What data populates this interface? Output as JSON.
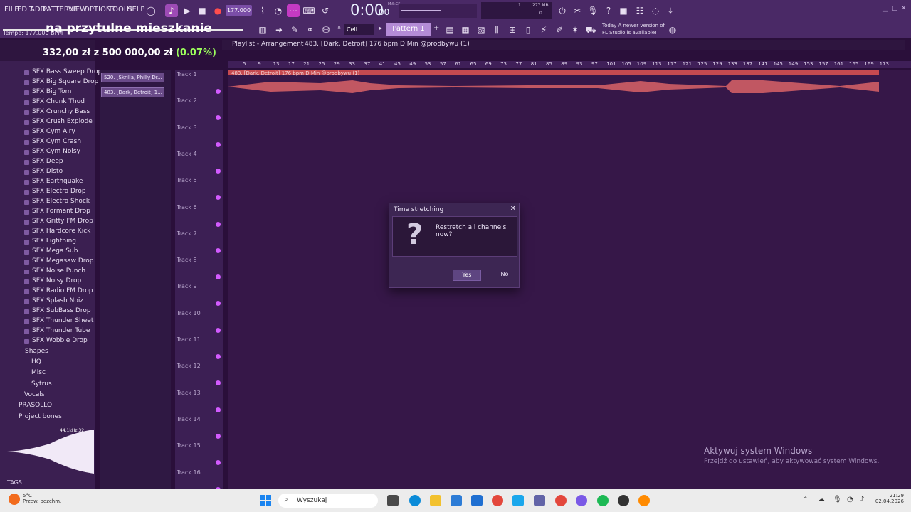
{
  "menu": [
    "FILE",
    "EDIT",
    "ADD",
    "PATTERNS",
    "VIEW",
    "OPTIONS",
    "TOOLS",
    "HELP"
  ],
  "transport": {
    "bpm": "177.000",
    "time": "0:00",
    "time_small": "00",
    "time_caption": "M:S:CS"
  },
  "pattern": "Pattern 1",
  "cell": "Cell",
  "cpu": {
    "mem": "277 MB",
    "line1": "1",
    "line2": "0"
  },
  "news": {
    "line1": "Today  A newer version of",
    "line2": "FL Studio is available!"
  },
  "overlay": {
    "title": "na przytulne mieszkanie",
    "tempo": "Tempo: 177.000 BPM"
  },
  "progress": {
    "current": "332,00 zł",
    "sep": " z ",
    "goal": "500 000,00 zł",
    "pct": "(0.07%)"
  },
  "browser": {
    "items": [
      "SFX Bass Sweep Drop",
      "SFX Big Square Drop",
      "SFX Big Tom",
      "SFX Chunk Thud",
      "SFX Crunchy Bass",
      "SFX Crush Explode",
      "SFX Cym Airy",
      "SFX Cym Crash",
      "SFX Cym Noisy",
      "SFX Deep",
      "SFX Disto",
      "SFX Earthquake",
      "SFX Electro Drop",
      "SFX Electro Shock",
      "SFX Formant Drop",
      "SFX Gritty FM Drop",
      "SFX Hardcore Kick",
      "SFX Lightning",
      "SFX Mega Sub",
      "SFX Megasaw Drop",
      "SFX Noise Punch",
      "SFX Noisy Drop",
      "SFX Radio FM Drop",
      "SFX Splash Noiz",
      "SFX SubBass Drop",
      "SFX Thunder Sheet",
      "SFX Thunder Tube",
      "SFX Wobble Drop"
    ],
    "groups": {
      "shapes": "Shapes",
      "hq": "HQ",
      "misc": "Misc",
      "sytrus": "Sytrus",
      "vocals": "Vocals",
      "prasollo": "PRASOLLO",
      "bones": "Project bones"
    },
    "tags": "TAGS",
    "samplerate": "44.1kHz 32"
  },
  "clips": [
    "520. [Skrilla, Philly Dr...",
    "483. [Dark, Detroit] 1..."
  ],
  "playlist": {
    "title": "Playlist - Arrangement",
    "clip": "483. [Dark, Detroit] 176 bpm D Min @prodbywu (1)",
    "strip": "483. [Dark, Detroit] 176 bpm D Min @prodbywu (1)"
  },
  "ruler": [
    "5",
    "9",
    "13",
    "17",
    "21",
    "25",
    "29",
    "33",
    "37",
    "41",
    "45",
    "49",
    "53",
    "57",
    "61",
    "65",
    "69",
    "73",
    "77",
    "81",
    "85",
    "89",
    "93",
    "97",
    "101",
    "105",
    "109",
    "113",
    "117",
    "121",
    "125",
    "129",
    "133",
    "137",
    "141",
    "145",
    "149",
    "153",
    "157",
    "161",
    "165",
    "169",
    "173"
  ],
  "tracks": [
    "Track 1",
    "Track 2",
    "Track 3",
    "Track 4",
    "Track 5",
    "Track 6",
    "Track 7",
    "Track 8",
    "Track 9",
    "Track 10",
    "Track 11",
    "Track 12",
    "Track 13",
    "Track 14",
    "Track 15",
    "Track 16"
  ],
  "dialog": {
    "title": "Time stretching",
    "message": "Restretch all channels now?",
    "yes": "Yes",
    "no": "No"
  },
  "activation": {
    "line1": "Aktywuj system Windows",
    "line2": "Przejdź do ustawień, aby aktywować system Windows."
  },
  "taskbar": {
    "search": "Wyszukaj",
    "weather_temp": "5°C",
    "weather_desc": "Przew. bezchm.",
    "time": "21:29",
    "date": "02.04.2026"
  }
}
